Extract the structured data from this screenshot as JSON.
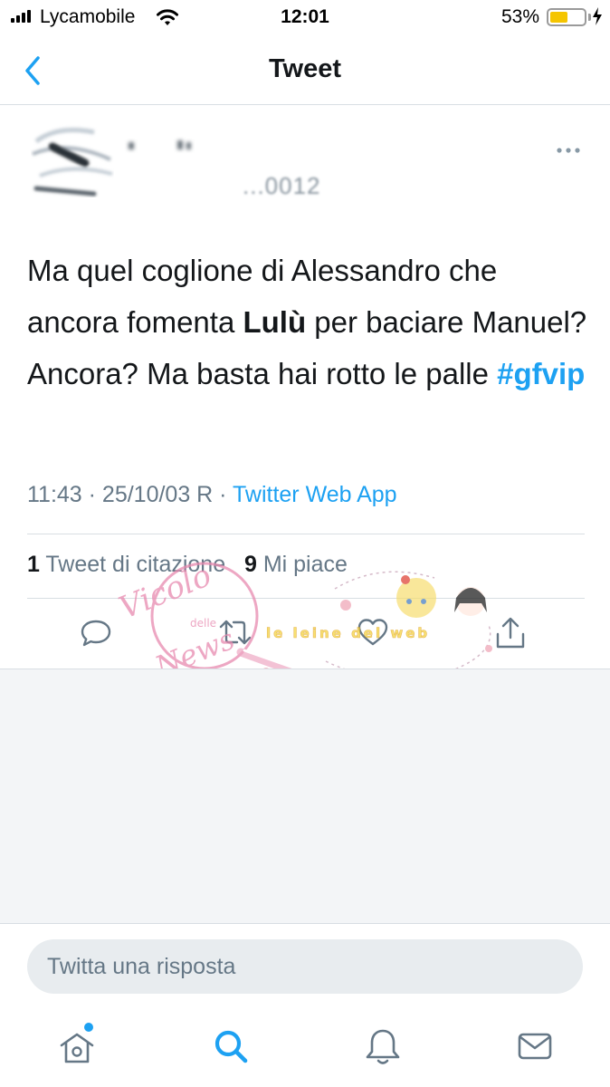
{
  "status_bar": {
    "carrier": "Lycamobile",
    "time": "12:01",
    "battery_percent": "53%",
    "battery_level": 0.53
  },
  "nav": {
    "title": "Tweet"
  },
  "author": {
    "handle_partial": "...0012"
  },
  "tweet": {
    "text_part1": "Ma quel coglione di Alessandro che ancora fomenta ",
    "bold": "Lulù",
    "text_part2": " per baciare Manuel? Ancora? Ma basta hai rotto le palle ",
    "hashtag": "#gfvip",
    "timestamp": "11:43 · 25/10/03 R · ",
    "source": "Twitter Web App"
  },
  "stats": {
    "quotes_count": "1",
    "quotes_label": " Tweet di citazione",
    "likes_count": "9",
    "likes_label": " Mi piace"
  },
  "reply": {
    "placeholder": "Twitta una risposta"
  },
  "watermark": {
    "brand": "Vicolo delle News",
    "brand_top": "Vicolo",
    "brand_mid": "delle",
    "brand_bottom": "News",
    "tagline": "le leine del web"
  },
  "colors": {
    "accent": "#1da1f2",
    "text": "#14171a",
    "muted": "#657786",
    "divider": "#d8dee3",
    "battery": "#f5c500",
    "watermark": "#e88ab0"
  },
  "icons": {
    "back": "chevron-left-icon",
    "more": "more-horizontal-icon",
    "reply": "reply-icon",
    "retweet": "retweet-icon",
    "like": "heart-icon",
    "share": "share-icon",
    "home": "home-icon",
    "search": "search-icon",
    "notifications": "bell-icon",
    "messages": "mail-icon"
  }
}
